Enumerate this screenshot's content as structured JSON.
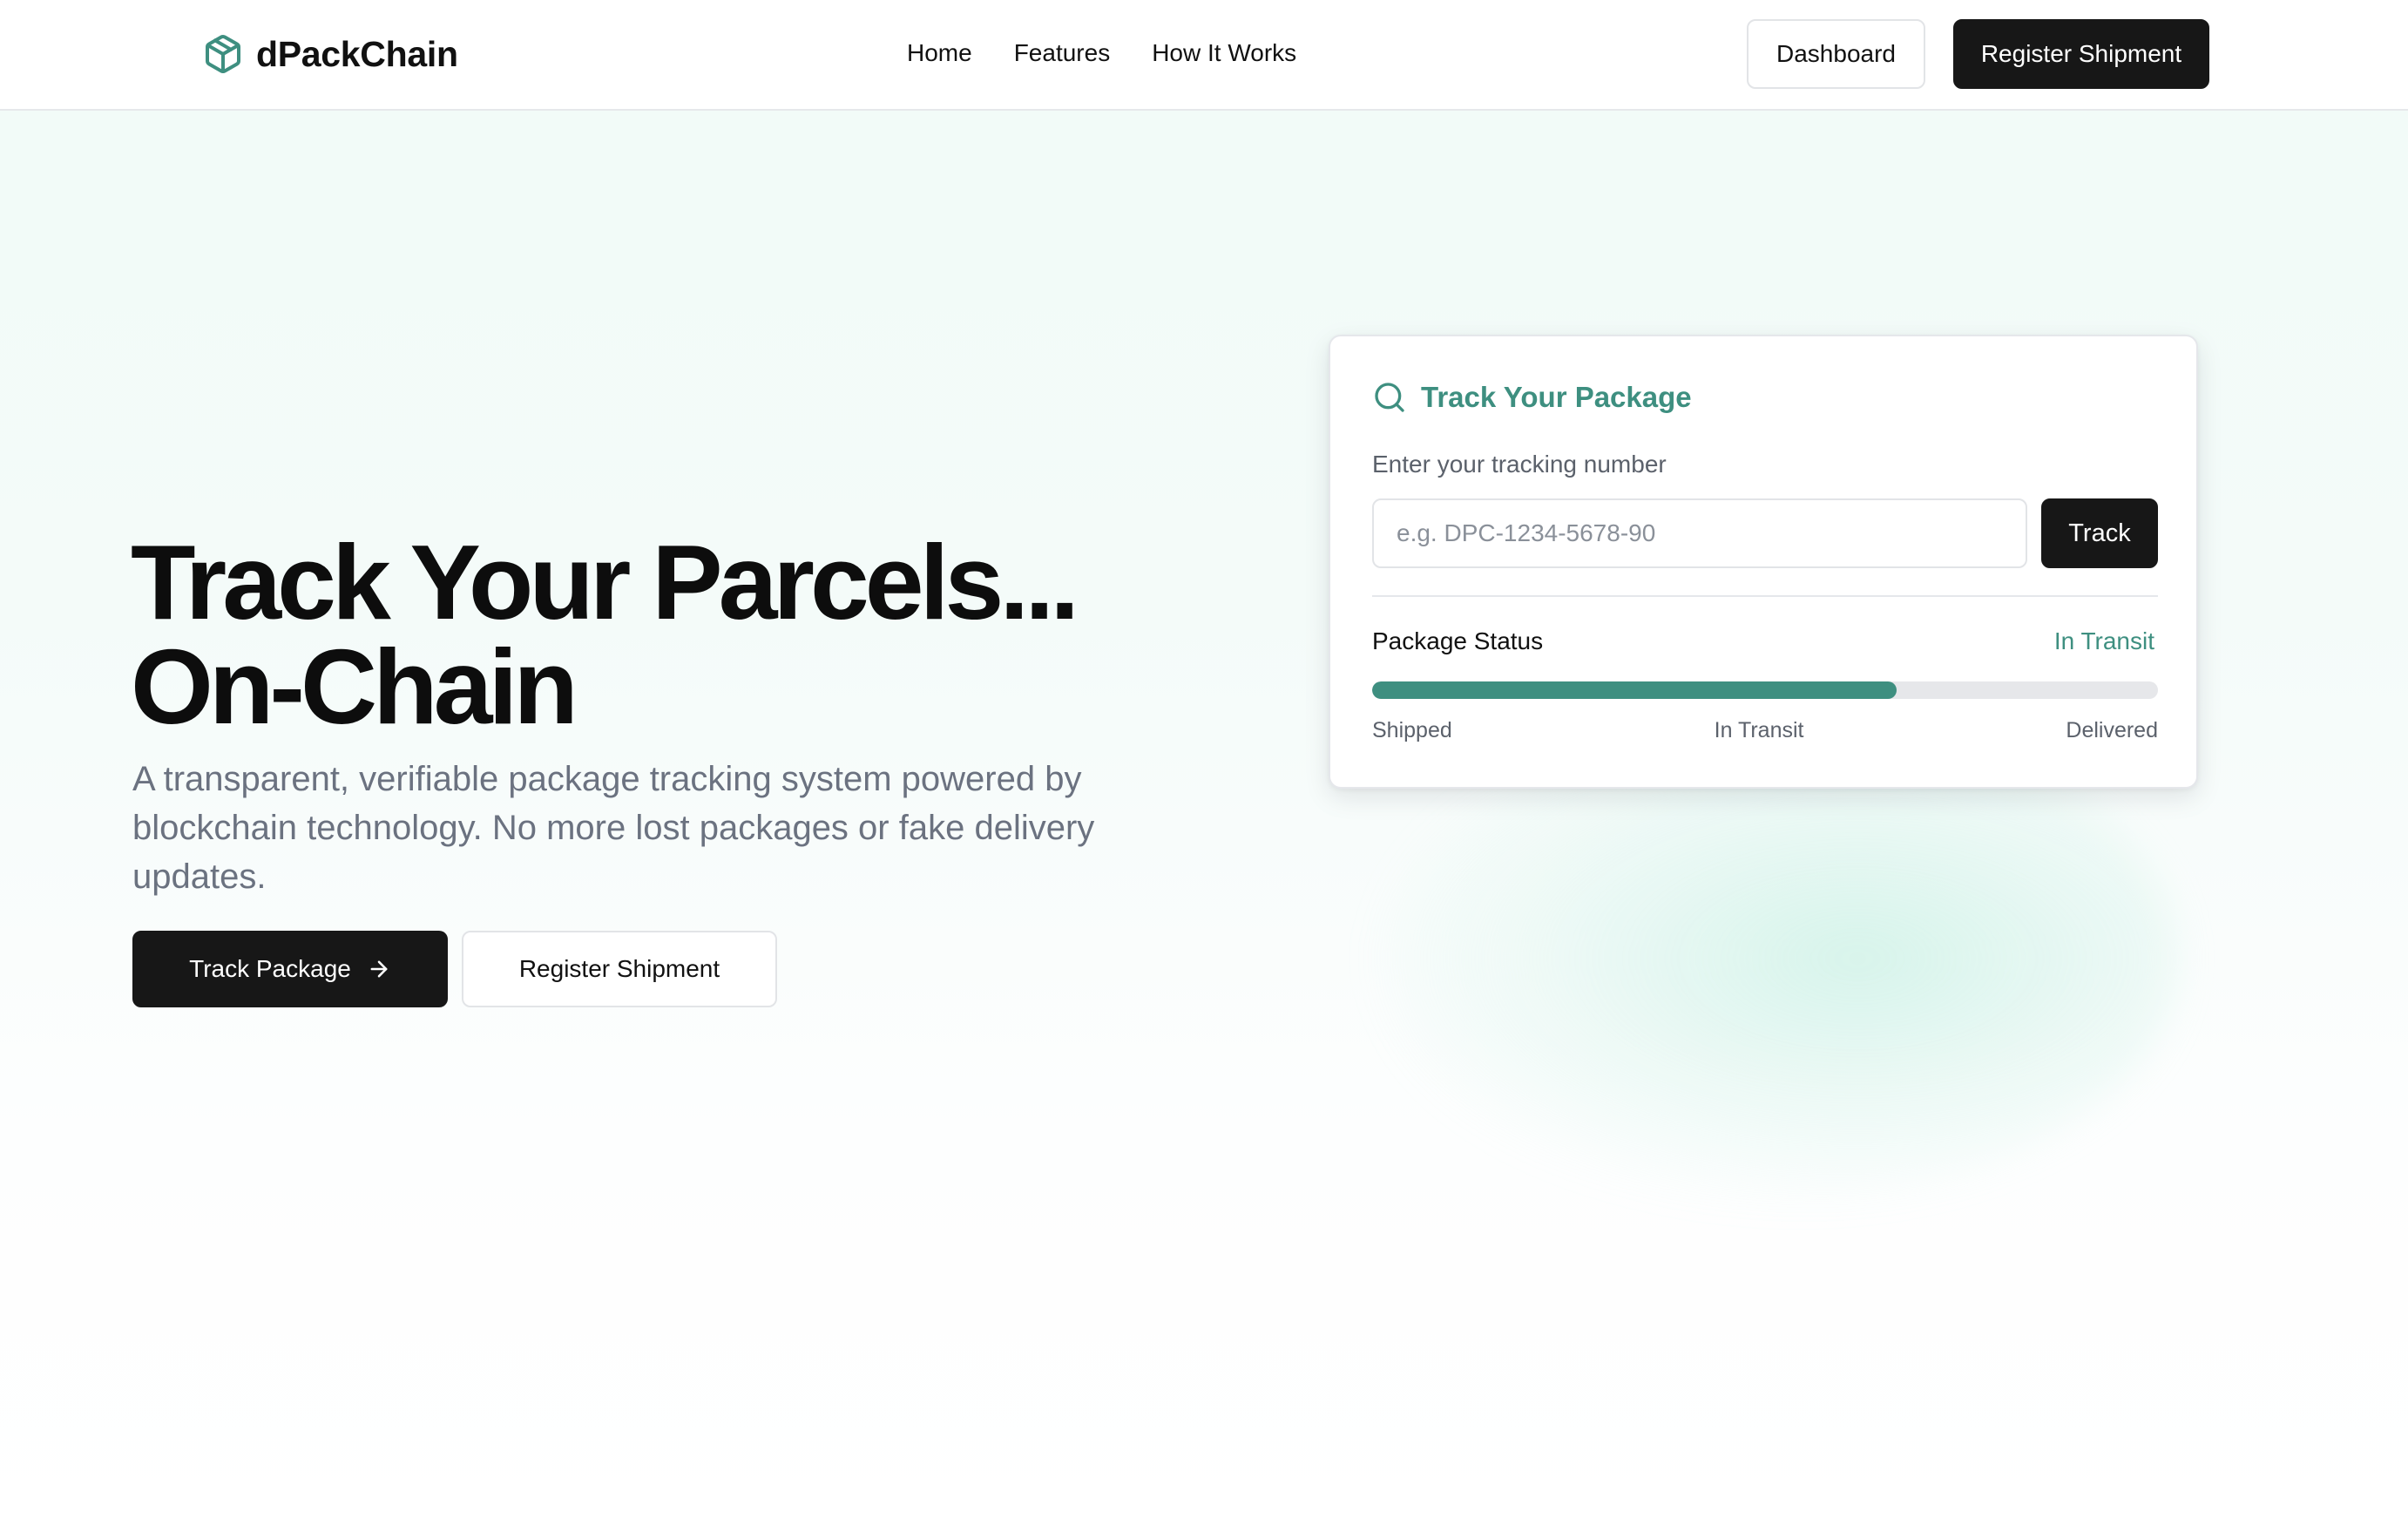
{
  "brand": {
    "name": "dPackChain",
    "logo_icon": "package-box-icon",
    "accent_color": "#3e8f80"
  },
  "nav": {
    "items": [
      {
        "label": "Home"
      },
      {
        "label": "Features"
      },
      {
        "label": "How It Works"
      }
    ]
  },
  "header_actions": {
    "dashboard_label": "Dashboard",
    "register_label": "Register Shipment"
  },
  "hero": {
    "title_line1": "Track Your Parcels...",
    "title_line2": "On-Chain",
    "subtitle": "A transparent, verifiable package tracking system powered by blockchain technology. No more lost packages or fake delivery updates.",
    "primary_button": "Track Package",
    "primary_button_icon": "arrow-right-icon",
    "secondary_button": "Register Shipment"
  },
  "tracker": {
    "title": "Track Your Package",
    "title_icon": "search-icon",
    "input_label": "Enter your tracking number",
    "input_placeholder": "e.g. DPC-1234-5678-90",
    "input_value": "",
    "track_button": "Track",
    "status_label": "Package Status",
    "status_value": "In Transit",
    "progress_fraction": 0.667,
    "steps": [
      "Shipped",
      "In Transit",
      "Delivered"
    ]
  }
}
